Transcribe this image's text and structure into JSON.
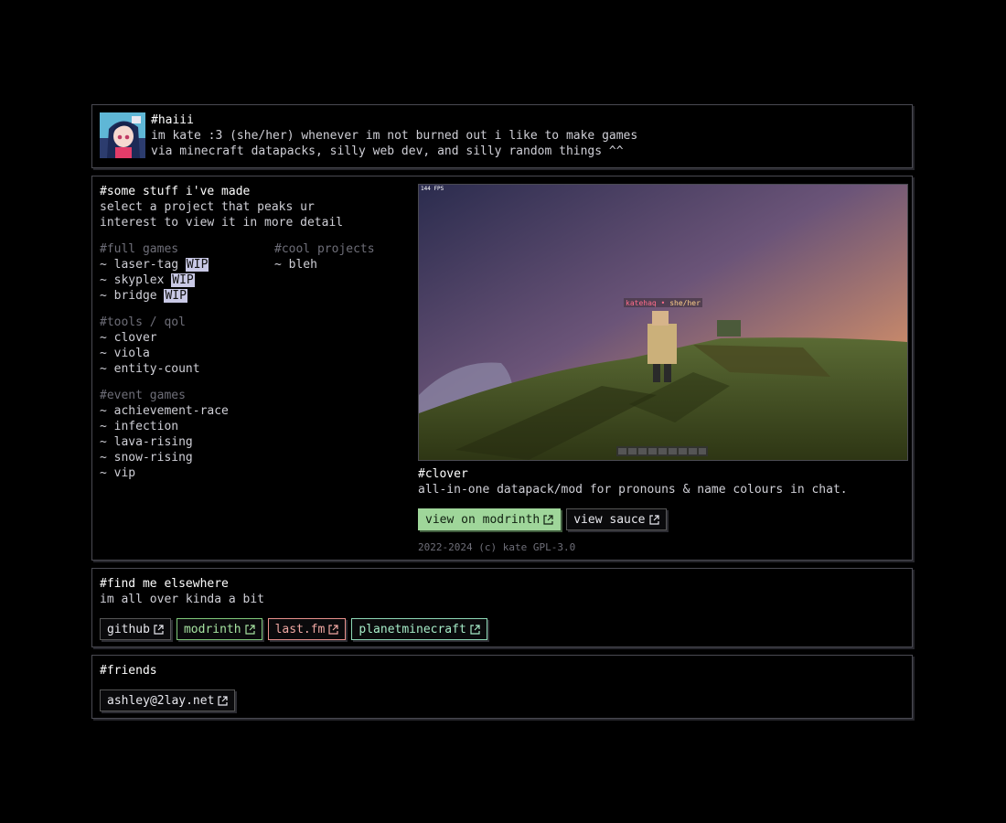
{
  "intro": {
    "title": "#haiii",
    "line1": "im kate :3 (she/her) whenever im not burned out i like to make games",
    "line2": "via minecraft datapacks, silly web dev, and silly random things ^^"
  },
  "projects": {
    "title": "#some stuff i've made",
    "subtitle1": "select a project that peaks ur",
    "subtitle2": "interest to view it in more detail",
    "full_games_label": "#full games",
    "full_games": [
      {
        "name": "~ laser-tag",
        "badge": "WIP"
      },
      {
        "name": "~ skyplex",
        "badge": "WIP"
      },
      {
        "name": "~ bridge",
        "badge": "WIP"
      }
    ],
    "cool_label": "#cool projects",
    "cool": [
      "~ bleh"
    ],
    "tools_label": "#tools / qol",
    "tools": [
      "~ clover",
      "~ viola",
      "~ entity-count"
    ],
    "event_label": "#event games",
    "event": [
      "~ achievement-race",
      "~ infection",
      "~ lava-rising",
      "~ snow-rising",
      "~ vip"
    ]
  },
  "screenshot": {
    "fps": "144 FPS",
    "nametag_name": "katehaq",
    "nametag_sep": "•",
    "nametag_pronouns": "she/her"
  },
  "selected": {
    "title": "#clover",
    "desc": "all-in-one datapack/mod for pronouns & name colours in chat.",
    "btn_modrinth": "view on modrinth",
    "btn_sauce": "view sauce",
    "footer": "2022-2024 (c) kate GPL-3.0"
  },
  "elsewhere": {
    "title": "#find me elsewhere",
    "subtitle": "im all over kinda a bit",
    "links": [
      "github",
      "modrinth",
      "last.fm",
      "planetminecraft"
    ]
  },
  "friends": {
    "title": "#friends",
    "links": [
      "ashley@2lay.net"
    ]
  },
  "colors": {
    "accent_green": "#9fd69a",
    "wip_badge": "#c9c9e6",
    "background": "#000000"
  }
}
